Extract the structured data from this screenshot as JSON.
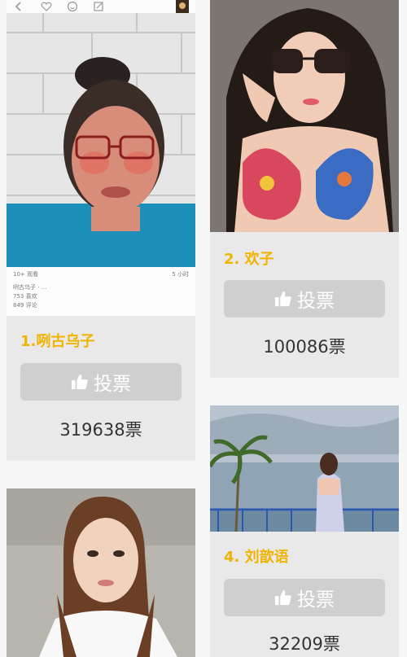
{
  "cards": [
    {
      "rank_name": "1.咧古乌子",
      "vote_label": "投票",
      "votes": "319638票",
      "caption": {
        "views": "10+ 观看",
        "time": "5 小时",
        "author": "咧古乌子 · ...",
        "likes": "753 喜欢",
        "comments": "849 评论"
      }
    },
    {
      "rank_name": "2. 欢子",
      "vote_label": "投票",
      "votes": "100086票"
    },
    {
      "rank_name": "4. 刘歆语",
      "vote_label": "投票",
      "votes": "32209票"
    }
  ],
  "icons": [
    "back-icon",
    "heart-icon",
    "emoji-icon",
    "edit-icon",
    "avatar-icon",
    "thumbs-up-icon"
  ],
  "colors": {
    "name_gold": "#f0b400",
    "button_gray": "#cfcfcf",
    "card_bg": "#e9e9e9"
  }
}
